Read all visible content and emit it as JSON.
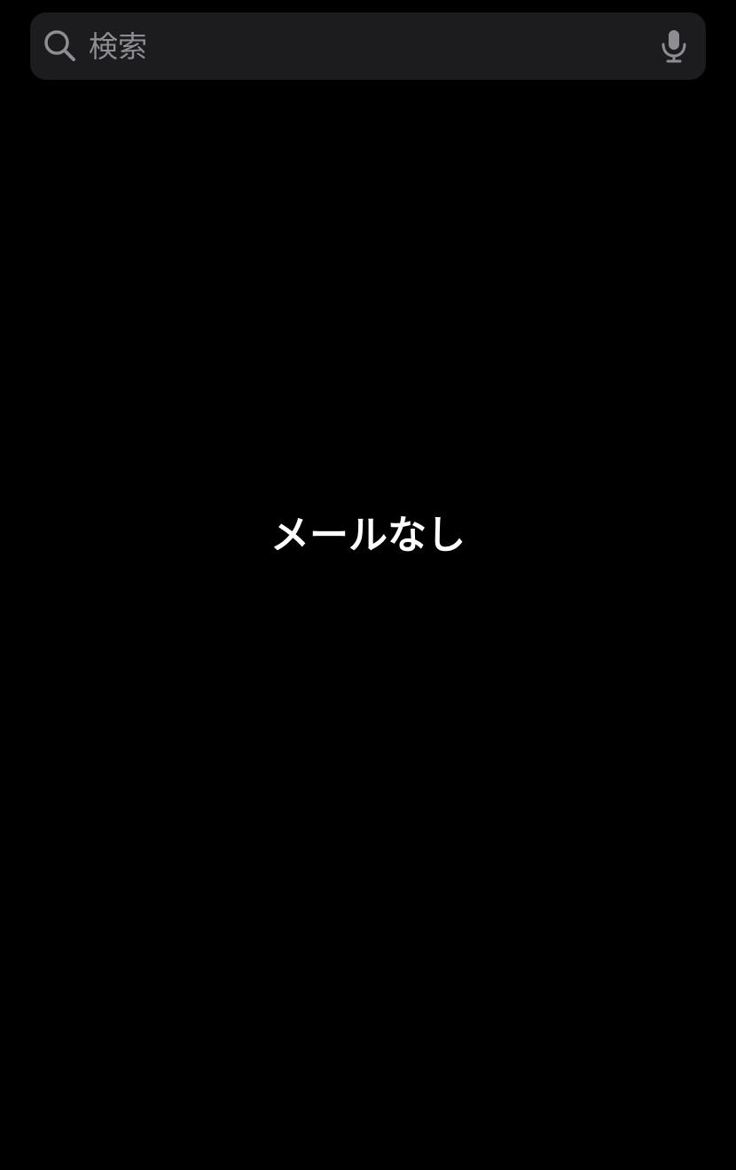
{
  "search": {
    "placeholder": "検索",
    "value": "",
    "icon": "search-icon",
    "mic_icon": "microphone-icon"
  },
  "mailbox": {
    "empty_message": "メールなし"
  },
  "colors": {
    "background": "#000000",
    "search_field": "#1c1c1e",
    "placeholder": "#8d8d93",
    "text": "#ffffff"
  }
}
